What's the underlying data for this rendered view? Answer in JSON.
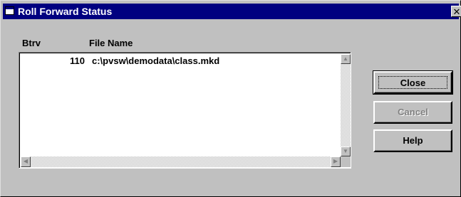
{
  "window": {
    "title": "Roll Forward Status",
    "close_glyph": "✕"
  },
  "list": {
    "columns": [
      "Btrv",
      "File Name"
    ],
    "rows": [
      {
        "btrv": "110",
        "file": "c:\\pvsw\\demodata\\class.mkd"
      }
    ]
  },
  "buttons": {
    "close": "Close",
    "cancel": "Cancel",
    "help": "Help"
  },
  "icons": {
    "scroll_up": "▲",
    "scroll_down": "▼",
    "scroll_left": "◀",
    "scroll_right": "▶"
  },
  "colors": {
    "titlebar": "#000080",
    "face": "#c0c0c0"
  }
}
